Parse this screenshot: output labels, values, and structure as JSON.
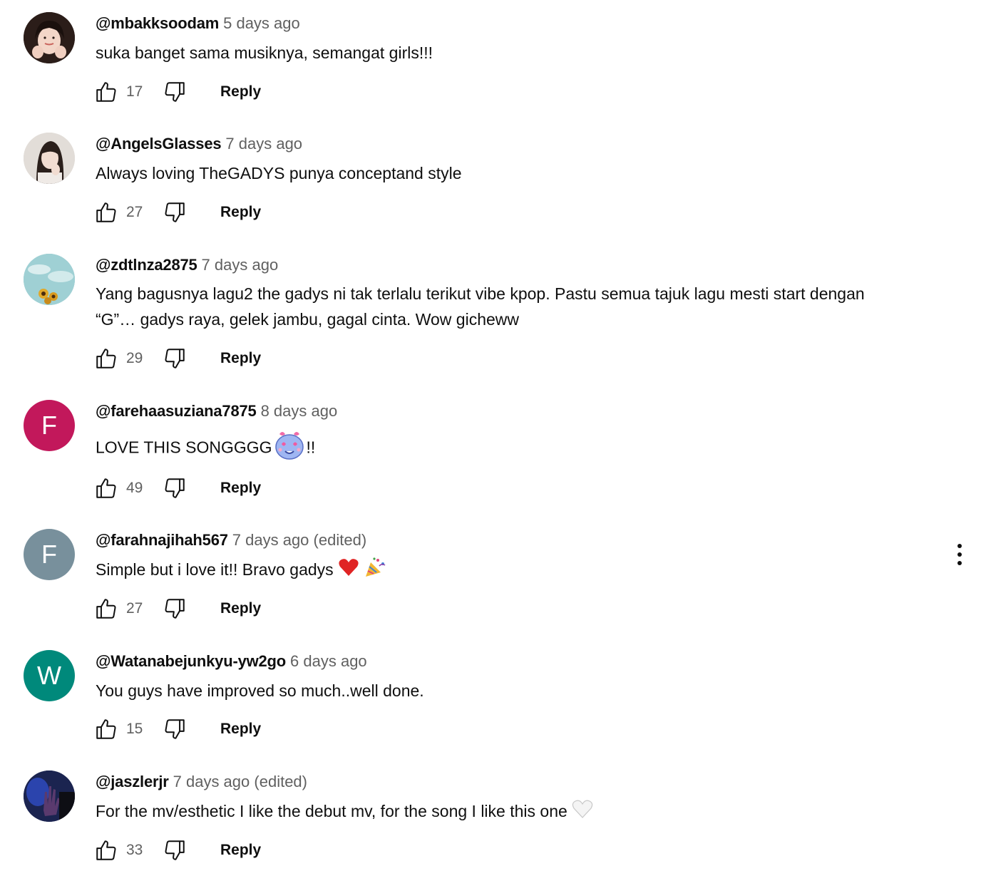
{
  "comments": [
    {
      "author": "@mbakksoodam",
      "time": "5 days ago",
      "edited": "",
      "text": "suka banget sama musiknya, semangat girls!!!",
      "likes": "17",
      "reply_label": "Reply",
      "avatar": {
        "type": "photo",
        "icon": "girl-portrait"
      }
    },
    {
      "author": "@AngelsGlasses",
      "time": "7 days ago",
      "edited": "",
      "text": "Always loving TheGADYS punya conceptand style",
      "likes": "27",
      "reply_label": "Reply",
      "avatar": {
        "type": "photo",
        "icon": "girl-portrait"
      }
    },
    {
      "author": "@zdtlnza2875",
      "time": "7 days ago",
      "edited": "",
      "text": "Yang bagusnya lagu2 the gadys ni tak terlalu terikut vibe kpop. Pastu semua tajuk lagu mesti start dengan “G”… gadys raya, gelek jambu, gagal cinta. Wow gicheww",
      "likes": "29",
      "reply_label": "Reply",
      "avatar": {
        "type": "photo",
        "icon": "sky-sunflowers"
      }
    },
    {
      "author": "@farehaasuziana7875",
      "time": "8 days ago",
      "edited": "",
      "text_before_emoji": "LOVE THIS SONGGGG",
      "text_after_emoji": "!!",
      "emoji": "heart-eyes-ghost-emoji",
      "likes": "49",
      "reply_label": "Reply",
      "avatar": {
        "type": "letter",
        "letter": "F",
        "color": "#c2185b"
      }
    },
    {
      "author": "@farahnajihah567",
      "time": "7 days ago",
      "edited": "(edited)",
      "text": "Simple but i love it!! Bravo gadys ",
      "emojis": [
        "red-heart-emoji",
        "party-popper-emoji"
      ],
      "likes": "27",
      "reply_label": "Reply",
      "avatar": {
        "type": "letter",
        "letter": "F",
        "color": "#78909c"
      }
    },
    {
      "author": "@Watanabejunkyu-yw2go",
      "time": "6 days ago",
      "edited": "",
      "text": "You guys have improved so much..well done.",
      "likes": "15",
      "reply_label": "Reply",
      "avatar": {
        "type": "letter",
        "letter": "W",
        "color": "#00897b"
      }
    },
    {
      "author": "@jaszlerjr",
      "time": "7 days ago",
      "edited": "(edited)",
      "text": "For the mv/esthetic I like the debut mv, for the song I like this one ",
      "emojis": [
        "white-heart-emoji"
      ],
      "likes": "33",
      "reply_label": "Reply",
      "avatar": {
        "type": "photo",
        "icon": "dark-hand-photo"
      }
    }
  ],
  "menu": {
    "icon": "more-vertical-icon"
  },
  "colors": {
    "text_primary": "#0f0f0f",
    "text_secondary": "#606060"
  }
}
